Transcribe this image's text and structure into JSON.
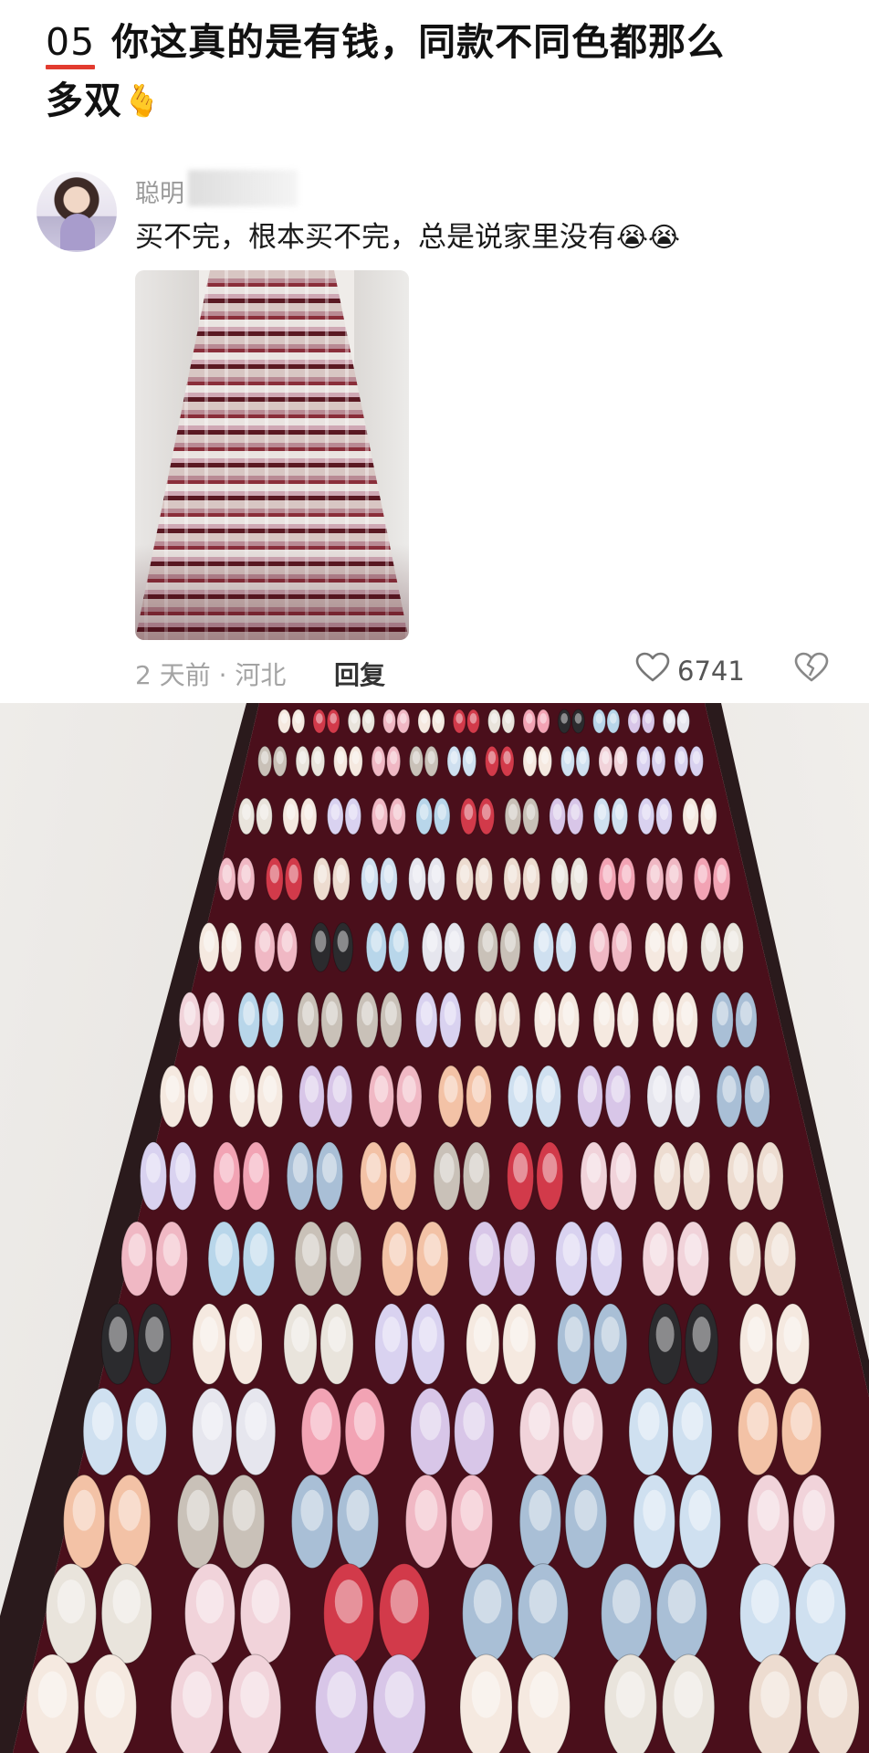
{
  "post": {
    "number": "05",
    "title_line1": "你这真的是有钱，同款不同色都那么",
    "title_line2": "多双",
    "title_emoji": "🫰"
  },
  "comment": {
    "username": "聪明",
    "text": "买不完，根本买不完，总是说家里没有",
    "emojis": "😭😭",
    "time_location": "2 天前 · 河北",
    "reply_label": "回复",
    "like_count": "6741"
  },
  "icons": {
    "like": "heart-outline-icon",
    "dislike": "broken-heart-icon"
  },
  "colors": {
    "accent_underline": "#e23b2f",
    "muted_text": "#a3a3a3",
    "carpet": "#4a0f1b"
  }
}
